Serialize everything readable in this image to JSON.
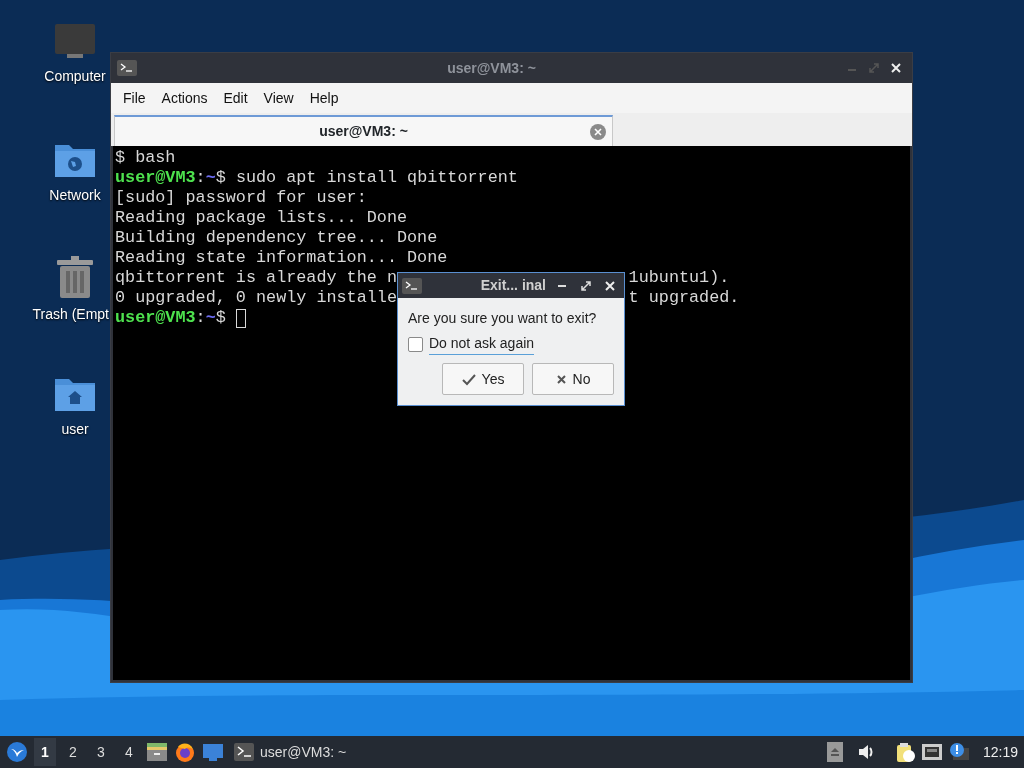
{
  "desktop_icons": [
    {
      "label": "Computer",
      "kind": "computer"
    },
    {
      "label": "Network",
      "kind": "network"
    },
    {
      "label": "Trash (Empt",
      "kind": "trash"
    },
    {
      "label": "user",
      "kind": "home"
    }
  ],
  "terminal_window": {
    "title": "user@VM3: ~",
    "active": false,
    "menu": [
      "File",
      "Actions",
      "Edit",
      "View",
      "Help"
    ],
    "tabs": [
      {
        "label": "user@VM3: ~",
        "selected": true
      }
    ],
    "lines": [
      {
        "segments": [
          {
            "kind": "plain",
            "text": "$ bash"
          }
        ]
      },
      {
        "segments": [
          {
            "kind": "user",
            "text": "user@VM3"
          },
          {
            "kind": "plain",
            "text": ":"
          },
          {
            "kind": "path",
            "text": "~"
          },
          {
            "kind": "plain",
            "text": "$ sudo apt install qbittorrent"
          }
        ]
      },
      {
        "segments": [
          {
            "kind": "plain",
            "text": "[sudo] password for user:"
          }
        ]
      },
      {
        "segments": [
          {
            "kind": "plain",
            "text": "Reading package lists... Done"
          }
        ]
      },
      {
        "segments": [
          {
            "kind": "plain",
            "text": "Building dependency tree... Done"
          }
        ]
      },
      {
        "segments": [
          {
            "kind": "plain",
            "text": "Reading state information... Done"
          }
        ]
      },
      {
        "segments": [
          {
            "kind": "plain",
            "text": "qbittorrent is already the n"
          },
          {
            "kind": "after_dialog",
            "text": "1ubuntu1)."
          }
        ]
      },
      {
        "segments": [
          {
            "kind": "plain",
            "text": "0 upgraded, 0 newly installe"
          },
          {
            "kind": "after_dialog",
            "text": "t upgraded."
          }
        ]
      },
      {
        "segments": [
          {
            "kind": "user",
            "text": "user@VM3"
          },
          {
            "kind": "plain",
            "text": ":"
          },
          {
            "kind": "path",
            "text": "~"
          },
          {
            "kind": "plain",
            "text": "$"
          }
        ],
        "cursor": true
      }
    ]
  },
  "dialog": {
    "title": "Exit... inal",
    "message": "Are you sure you want to exit?",
    "checkbox": {
      "label": "Do not ask again",
      "checked": false
    },
    "buttons": [
      {
        "label": "Yes",
        "kind": "yes"
      },
      {
        "label": "No",
        "kind": "no"
      }
    ]
  },
  "taskbar": {
    "workspaces": [
      {
        "label": "1",
        "selected": true
      },
      {
        "label": "2",
        "selected": false
      },
      {
        "label": "3",
        "selected": false
      },
      {
        "label": "4",
        "selected": false
      }
    ],
    "tasks": [
      {
        "label": "user@VM3: ~"
      }
    ],
    "clock": "12:19"
  }
}
